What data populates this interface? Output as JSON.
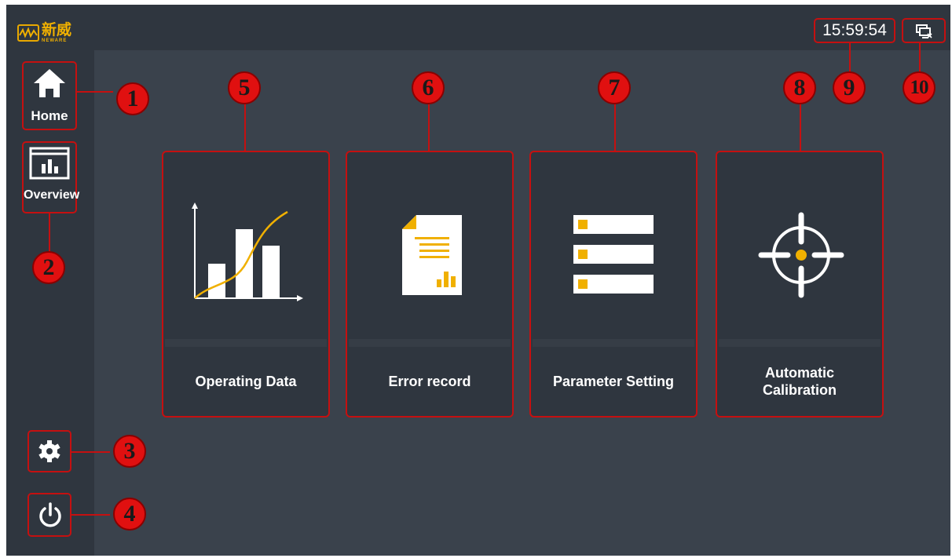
{
  "header": {
    "logo_cn": "新威",
    "logo_en": "NEWARE",
    "clock": "15:59:54",
    "network_icon": "network-disconnected-icon"
  },
  "sidebar": {
    "items": [
      {
        "label": "Home",
        "icon": "home-icon"
      },
      {
        "label": "Overview",
        "icon": "bar-chart-window-icon"
      },
      {
        "label": "",
        "icon": "gear-icon"
      },
      {
        "label": "",
        "icon": "power-icon"
      }
    ]
  },
  "cards": [
    {
      "label": "Operating Data",
      "icon": "chart-icon"
    },
    {
      "label": "Error record",
      "icon": "document-report-icon"
    },
    {
      "label": "Parameter Setting",
      "icon": "settings-list-icon"
    },
    {
      "label": "Automatic Calibration",
      "icon": "crosshair-icon"
    }
  ],
  "callouts": [
    "1",
    "2",
    "3",
    "4",
    "5",
    "6",
    "7",
    "8",
    "9",
    "10"
  ],
  "colors": {
    "background": "#3a424c",
    "panel": "#2f363f",
    "accent": "#f0b000",
    "annotation": "#c51010",
    "callout_fill": "#e01010"
  }
}
